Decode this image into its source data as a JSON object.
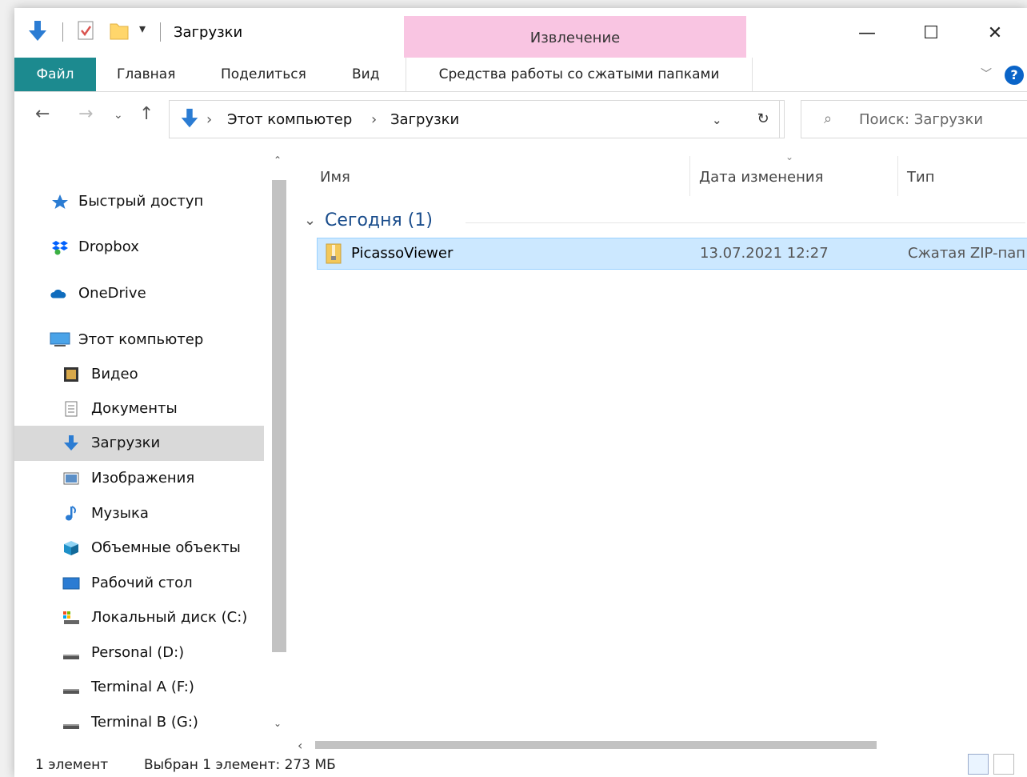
{
  "window": {
    "title": "Загрузки",
    "context_tab_header": "Извлечение",
    "controls": {
      "minimize": "—",
      "maximize": "☐",
      "close": "✕"
    }
  },
  "ribbon": {
    "tabs": [
      "Файл",
      "Главная",
      "Поделиться",
      "Вид"
    ],
    "context_tab": "Средства работы со сжатыми папками",
    "help": "?"
  },
  "address": {
    "crumbs": [
      "Этот компьютер",
      "Загрузки"
    ],
    "search_placeholder": "Поиск: Загрузки"
  },
  "nav": {
    "groups": [
      {
        "label": "Быстрый доступ",
        "icon": "star-icon"
      },
      {
        "label": "Dropbox",
        "icon": "dropbox-icon"
      },
      {
        "label": "OneDrive",
        "icon": "cloud-icon"
      },
      {
        "label": "Этот компьютер",
        "icon": "computer-icon"
      }
    ],
    "items": [
      {
        "label": "Видео",
        "icon": "video-icon"
      },
      {
        "label": "Документы",
        "icon": "document-icon"
      },
      {
        "label": "Загрузки",
        "icon": "download-icon",
        "selected": true
      },
      {
        "label": "Изображения",
        "icon": "pictures-icon"
      },
      {
        "label": "Музыка",
        "icon": "music-icon"
      },
      {
        "label": "Объемные объекты",
        "icon": "3d-objects-icon"
      },
      {
        "label": "Рабочий стол",
        "icon": "desktop-icon"
      },
      {
        "label": "Локальный диск (C:)",
        "icon": "system-drive-icon"
      },
      {
        "label": "Personal (D:)",
        "icon": "drive-icon"
      },
      {
        "label": "Terminal A (F:)",
        "icon": "drive-icon"
      },
      {
        "label": "Terminal B (G:)",
        "icon": "drive-icon"
      }
    ]
  },
  "content": {
    "columns": [
      "Имя",
      "Дата изменения",
      "Тип"
    ],
    "group_label": "Сегодня (1)",
    "files": [
      {
        "name": "PicassoViewer",
        "modified": "13.07.2021 12:27",
        "type": "Сжатая ZIP-пап",
        "icon": "zip-folder-icon",
        "selected": true
      }
    ]
  },
  "status": {
    "count": "1 элемент",
    "selection": "Выбран 1 элемент: 273 МБ"
  },
  "colors": {
    "accent": "#1c8a8f",
    "context": "#f9c5e2",
    "selection": "#cce8ff",
    "download_blue": "#2b7cd3"
  }
}
